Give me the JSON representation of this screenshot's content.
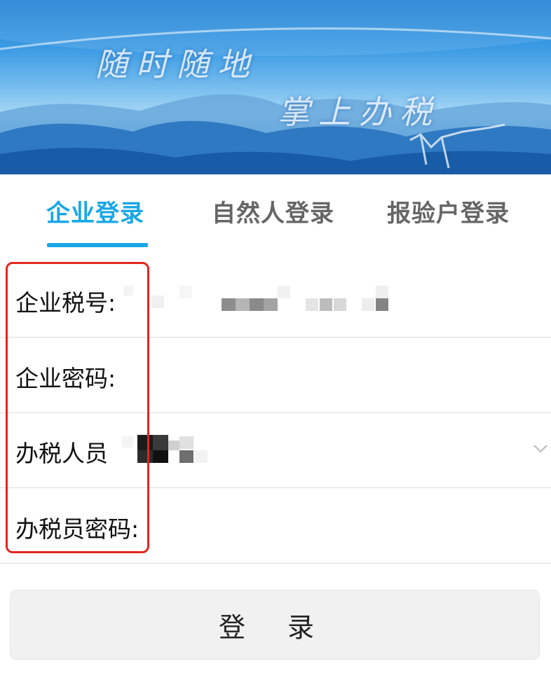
{
  "banner": {
    "line1": "随时随地",
    "line2": "掌上办税"
  },
  "tabs": [
    {
      "label": "企业登录",
      "active": true
    },
    {
      "label": "自然人登录",
      "active": false
    },
    {
      "label": "报验户登录",
      "active": false
    }
  ],
  "form": {
    "tax_id_label": "企业税号:",
    "password_label": "企业密码:",
    "tax_staff_label": "办税人员",
    "staff_password_label": "办税员密码:"
  },
  "login_button": "登 录",
  "colors": {
    "accent": "#19a7e6",
    "highlight": "#e2261e"
  },
  "icons": {
    "dropdown": "chevron-down-icon"
  }
}
